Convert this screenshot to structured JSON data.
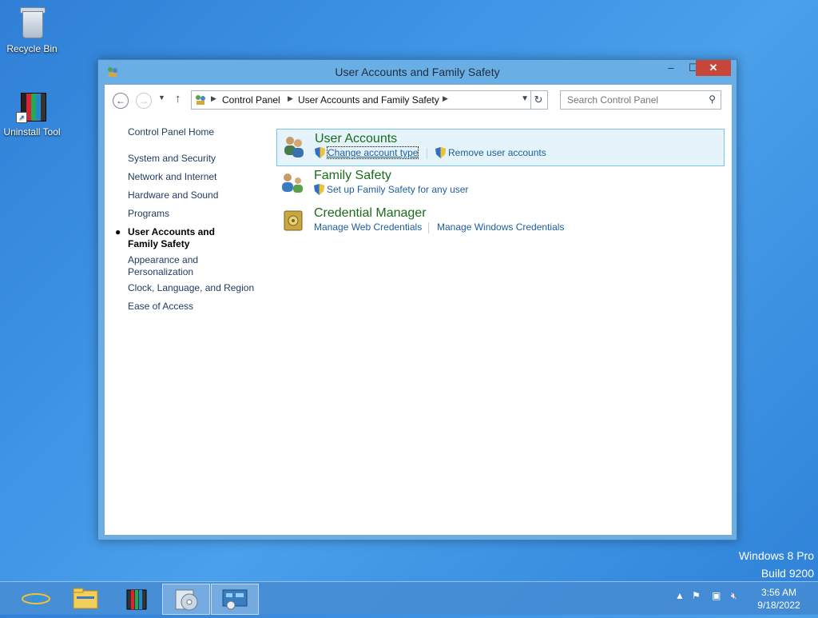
{
  "desktop": {
    "icons": [
      {
        "label": "Recycle Bin"
      },
      {
        "label": "Uninstall Tool"
      }
    ],
    "watermark": {
      "line1": "Windows 8 Pro",
      "line2": "Build 9200"
    }
  },
  "window": {
    "title": "User Accounts and Family Safety",
    "buttons": {
      "minimize": "–",
      "maximize": "☐",
      "close": "✕"
    },
    "address": {
      "crumbs": [
        "Control Panel",
        "User Accounts and Family Safety"
      ]
    },
    "search": {
      "placeholder": "Search Control Panel"
    },
    "leftnav": {
      "home": "Control Panel Home",
      "items": [
        "System and Security",
        "Network and Internet",
        "Hardware and Sound",
        "Programs",
        "User Accounts and Family Safety",
        "Appearance and Personalization",
        "Clock, Language, and Region",
        "Ease of Access"
      ],
      "current_index": 4
    },
    "categories": [
      {
        "title": "User Accounts",
        "links": [
          "Change account type",
          "Remove user accounts"
        ]
      },
      {
        "title": "Family Safety",
        "links": [
          "Set up Family Safety for any user"
        ]
      },
      {
        "title": "Credential Manager",
        "links": [
          "Manage Web Credentials",
          "Manage Windows Credentials"
        ]
      }
    ]
  },
  "taskbar": {
    "apps": [
      {
        "icon": "internet-explorer-icon"
      },
      {
        "icon": "file-explorer-icon"
      },
      {
        "icon": "uninstall-tool-icon"
      },
      {
        "icon": "disc-burner-icon"
      },
      {
        "icon": "control-panel-icon"
      }
    ],
    "clock": {
      "time": "3:56 AM",
      "date": "9/18/2022"
    }
  },
  "colors": {
    "accent_green": "#1a6b1a",
    "link_blue": "#1e5d9e",
    "close_red": "#c7463a"
  }
}
